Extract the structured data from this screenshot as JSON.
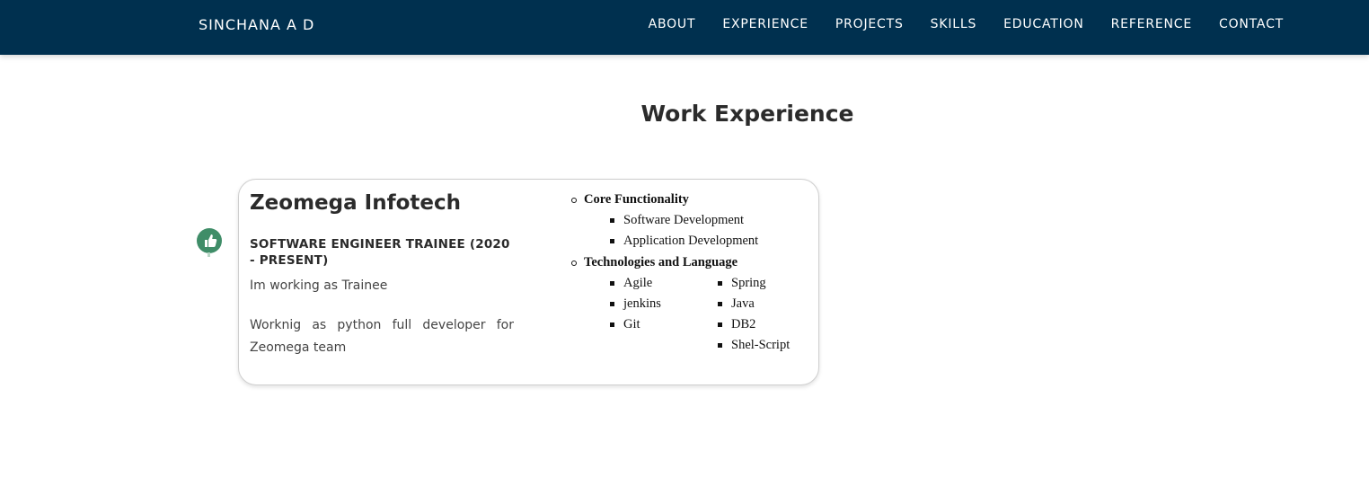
{
  "nav": {
    "brand": "SINCHANA A D",
    "links": [
      "ABOUT",
      "EXPERIENCE",
      "PROJECTS",
      "SKILLS",
      "EDUCATION",
      "REFERENCE",
      "CONTACT"
    ]
  },
  "section": {
    "title": "Work Experience"
  },
  "experience": {
    "company": "Zeomega Infotech",
    "role": "SOFTWARE ENGINEER TRAINEE (2020 - PRESENT)",
    "summary": "Im working as Trainee",
    "description": "Worknig as python full developer for Zeomega team",
    "core_heading": "Core Functionality",
    "core_items": [
      "Software Development",
      "Application Development"
    ],
    "tech_heading": "Technologies and Language",
    "tech_col1": [
      "Agile",
      "jenkins",
      "Git"
    ],
    "tech_col2": [
      "Spring",
      "Java",
      "DB2",
      "Shel-Script"
    ],
    "badge_icon": "thumbs-up-icon"
  },
  "colors": {
    "navbar": "#00304f",
    "badge": "#3f8d68"
  }
}
